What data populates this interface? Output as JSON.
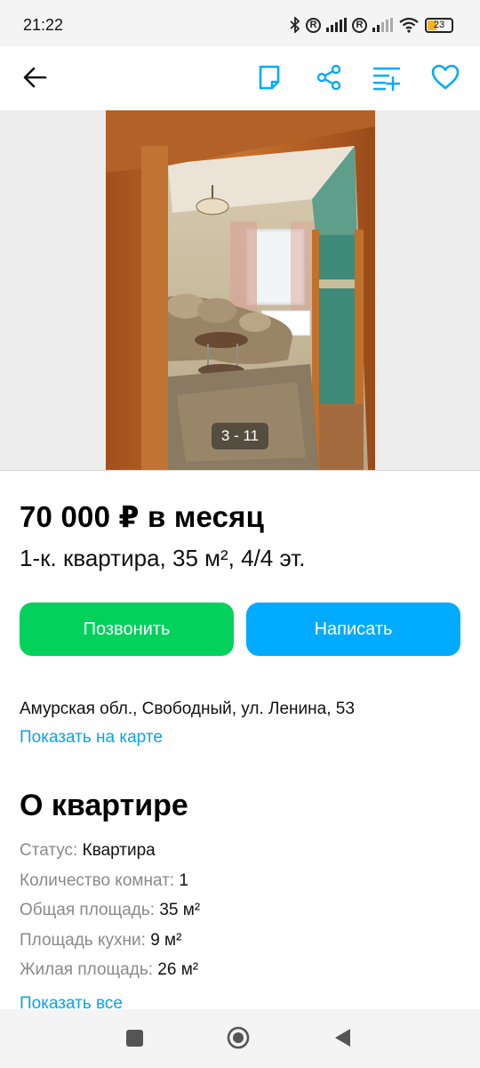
{
  "status_bar": {
    "time": "21:22",
    "battery_level": "23",
    "icons": [
      "bluetooth-icon",
      "registered-icon",
      "signal-icon",
      "registered-icon",
      "signal-icon",
      "wifi-icon",
      "battery-icon"
    ]
  },
  "toolbar": {
    "icons": [
      "back-arrow-icon",
      "note-icon",
      "share-icon",
      "compare-icon",
      "heart-icon"
    ]
  },
  "gallery": {
    "counter": "3 - 11"
  },
  "listing": {
    "price": "70 000 ₽ в месяц",
    "subtitle": "1-к. квартира, 35 м², 4/4 эт.",
    "call_label": "Позвонить",
    "message_label": "Написать",
    "address": "Амурская обл., Свободный, ул. Ленина, 53",
    "show_on_map": "Показать на карте"
  },
  "about": {
    "title": "О квартире",
    "params": [
      {
        "key": "Статус:",
        "value": "Квартира"
      },
      {
        "key": "Количество комнат:",
        "value": "1"
      },
      {
        "key": "Общая площадь:",
        "value": "35 м²"
      },
      {
        "key": "Площадь кухни:",
        "value": "9 м²"
      },
      {
        "key": "Жилая площадь:",
        "value": "26 м²"
      }
    ],
    "show_all": "Показать все"
  },
  "colors": {
    "call_button": "#02d15c",
    "message_button": "#00aaff",
    "link": "#0aa3e6",
    "accent_icons": "#00aaff"
  }
}
